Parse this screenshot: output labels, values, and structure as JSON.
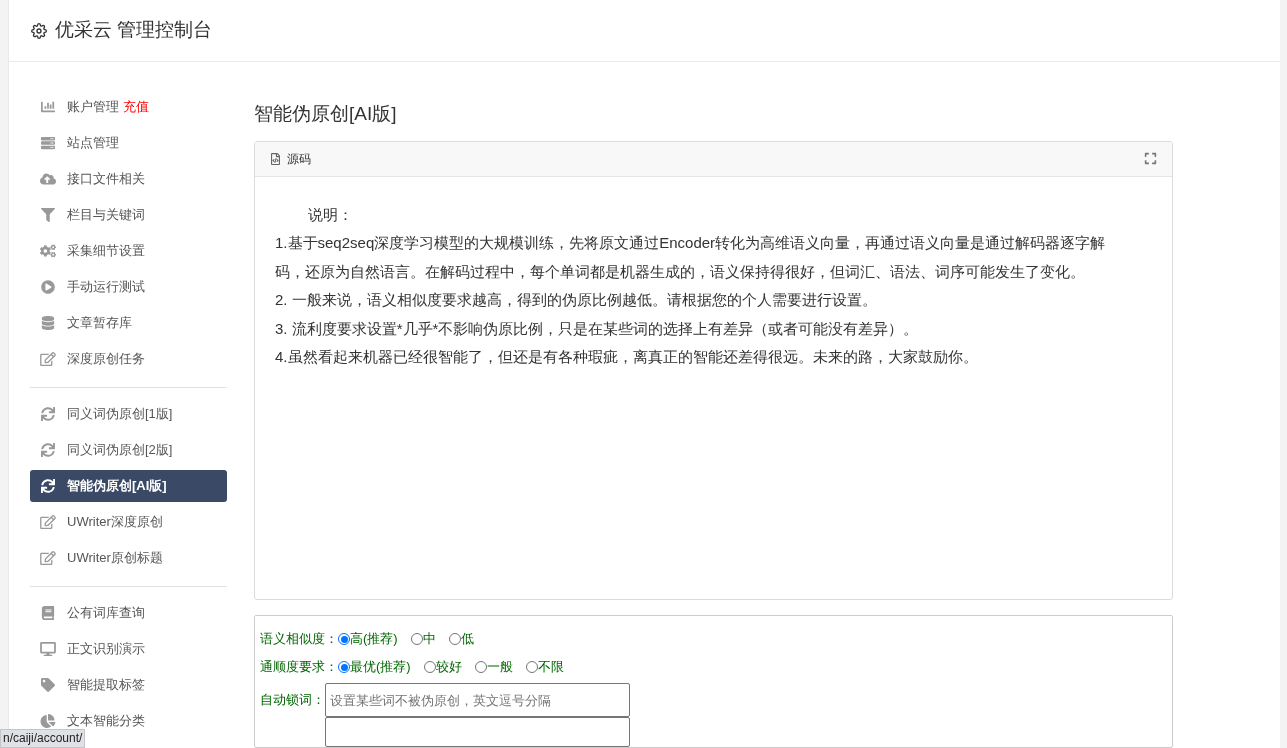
{
  "header": {
    "title": "优采云 管理控制台"
  },
  "sidebar": {
    "groups": [
      [
        {
          "label": "账户管理",
          "badge": "充值",
          "selected": false
        },
        {
          "label": "站点管理",
          "selected": false
        },
        {
          "label": "接口文件相关",
          "selected": false
        },
        {
          "label": "栏目与关键词",
          "selected": false
        },
        {
          "label": "采集细节设置",
          "selected": false
        },
        {
          "label": "手动运行测试",
          "selected": false
        },
        {
          "label": "文章暂存库",
          "selected": false
        },
        {
          "label": "深度原创任务",
          "selected": false
        }
      ],
      [
        {
          "label": "同义词伪原创[1版]",
          "selected": false
        },
        {
          "label": "同义词伪原创[2版]",
          "selected": false
        },
        {
          "label": "智能伪原创[AI版]",
          "selected": true
        },
        {
          "label": "UWriter深度原创",
          "selected": false
        },
        {
          "label": "UWriter原创标题",
          "selected": false
        }
      ],
      [
        {
          "label": "公有词库查询",
          "selected": false
        },
        {
          "label": "正文识别演示",
          "selected": false
        },
        {
          "label": "智能提取标签",
          "selected": false
        },
        {
          "label": "文本智能分类",
          "selected": false
        }
      ]
    ]
  },
  "page_title": "智能伪原创[AI版]",
  "editor": {
    "toolbar_label": "源码",
    "heading": "说明：",
    "paragraphs": [
      "1.基于seq2seq深度学习模型的大规模训练，先将原文通过Encoder转化为高维语义向量，再通过语义向量是通过解码器逐字解码，还原为自然语言。在解码过程中，每个单词都是机器生成的，语义保持得很好，但词汇、语法、词序可能发生了变化。",
      "2. 一般来说，语义相似度要求越高，得到的伪原比例越低。请根据您的个人需要进行设置。",
      "3. 流利度要求设置*几乎*不影响伪原比例，只是在某些词的选择上有差异（或者可能没有差异）。",
      "4.虽然看起来机器已经很智能了，但还是有各种瑕疵，离真正的智能还差得很远。未来的路，大家鼓励你。"
    ]
  },
  "options": {
    "radio_groups": [
      {
        "label": "语义相似度：",
        "options": [
          {
            "label": "高(推荐)",
            "selected": true
          },
          {
            "label": "中",
            "selected": false
          },
          {
            "label": "低",
            "selected": false
          }
        ]
      },
      {
        "label": "通顺度要求：",
        "options": [
          {
            "label": "最优(推荐)",
            "selected": true
          },
          {
            "label": "较好",
            "selected": false
          },
          {
            "label": "一般",
            "selected": false
          },
          {
            "label": "不限",
            "selected": false
          }
        ]
      }
    ],
    "lock_words": {
      "label": "自动锁词：",
      "placeholder": "设置某些词不被伪原创，英文逗号分隔"
    }
  },
  "status_bar": {
    "url": "n/caiji/account/"
  }
}
